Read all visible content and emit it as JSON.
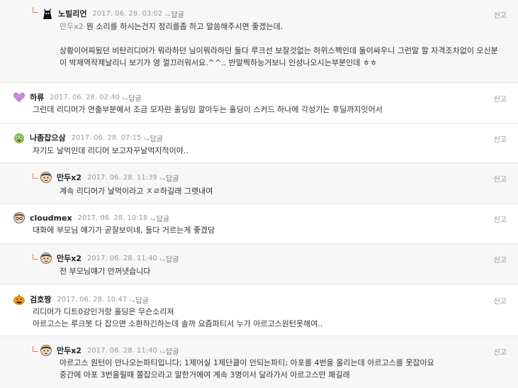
{
  "report_label": "신고",
  "reply_label": "답글",
  "comments": [
    {
      "nick": "노빌리언",
      "date": "2017. 06. 28. 03:02",
      "mention": "만두x2",
      "body": "뭔 소리를 하시는건지 정리를좀 하고 말씀해주시면 좋겠는데.\n\n상황이어찌됬던 비탄리디머가 뭐라하던 님이뭐라하던 둘다 루크선 보잘것없는 하위스펙인데 둘이싸우니 그런말 할 자격조차없이 오신분이 박제역작제날리니 보기가 영 껄끄러워서요.^^.. 반말찍하능거보니 인성나오시는부분인데 ㅎㅎ",
      "avatar": "black-cat-icon"
    },
    {
      "nick": "하류",
      "date": "2017. 06. 28. 02:40",
      "body": "그런데 리디머가 연출부분에서 조금 모자란 홀딩임 깔아두는 홀딩이 스커드 하나에 각성기는 후딜까지잇어서",
      "avatar": "purple-heart-icon"
    },
    {
      "nick": "나좀잡으삼",
      "date": "2017. 06. 28. 07:15",
      "body": "자기도 날먹인데 리디머 보고자꾸날먹지적이야..",
      "avatar": "green-creature-icon"
    },
    {
      "nick": "만두x2",
      "date": "2017. 06. 28. 11:39",
      "body": "계속 리디머가 날먹이라고 ㅈㄹ하길래 그랫내여",
      "avatar": "boy-face-icon"
    },
    {
      "nick": "cloudmex",
      "date": "2017. 06. 28. 10:18",
      "body": "대화에 부모님 얘기가 곧잘보이네, 둘다 거르는게 좋겠당",
      "avatar": "glasses-face-icon"
    },
    {
      "nick": "만두x2",
      "date": "2017. 06. 28. 11:40",
      "body": "전 부모님얘기 안꺼냇습니다",
      "avatar": "boy-face-icon"
    },
    {
      "nick": "검호짱",
      "date": "2017. 06. 28. 10:47",
      "body": "리디머가 디트0강인거랑 홀딩은 무슨소리져\n아르고스는 루크봇 다 잡으면 소환하긴하는데 솔까 요즘파티서 누가 아르고스원턴못해여..",
      "avatar": "pumpkin-icon"
    },
    {
      "nick": "만두x2",
      "date": "2017. 06. 28. 11:40",
      "body": "아르고스 원턴이 안나오는파티입니다; 1제어실 1제단클이 안되는파티; 아포를 4번을 올리는데 아르고스를 못잡아요\n중간에 아포 3번올릴때 쫄잡으라고 말한거에여 계속 3명이서 달라가서 아르고스만 패길래",
      "avatar": "boy-face-icon"
    }
  ]
}
